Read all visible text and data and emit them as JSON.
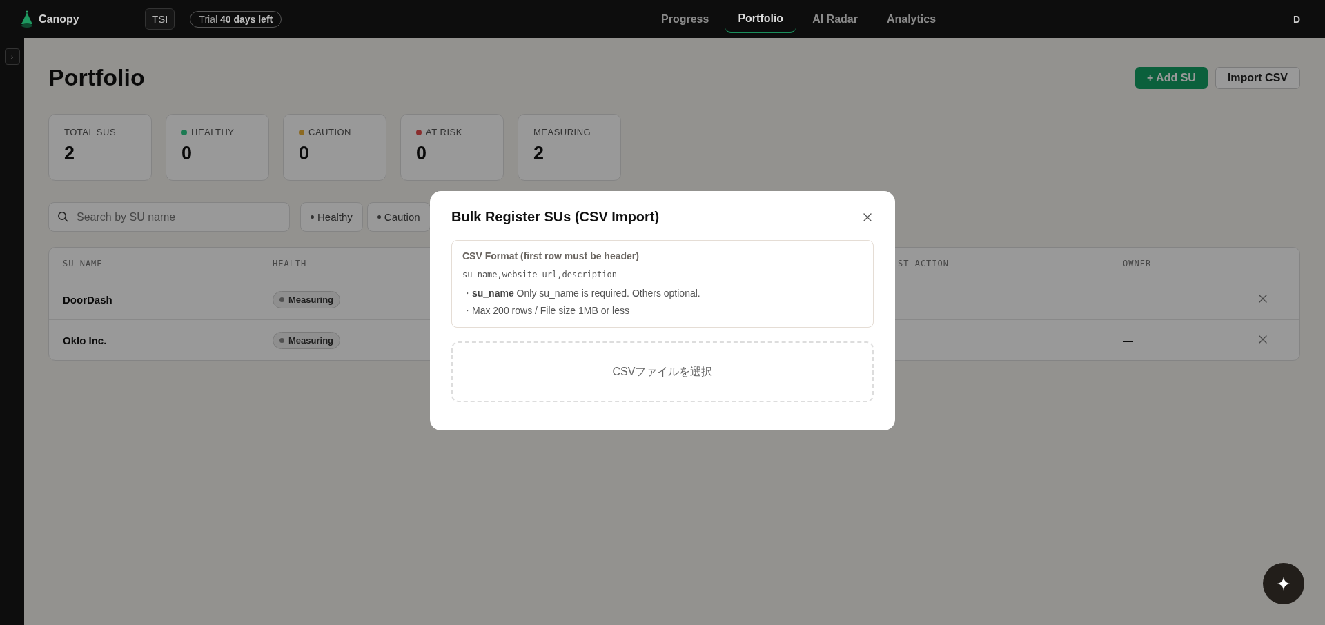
{
  "topbar": {
    "brand": "Canopy",
    "org": "TSI",
    "trial": "Trial **40 days left**",
    "nav": [
      {
        "label": "Progress",
        "selected": false
      },
      {
        "label": "Portfolio",
        "selected": true
      },
      {
        "label": "AI Radar",
        "selected": false
      },
      {
        "label": "Analytics",
        "selected": false
      }
    ],
    "user": "D"
  },
  "sidebar": {
    "toggle": "›"
  },
  "page": {
    "title": "Portfolio",
    "buttons": [
      {
        "label": "+ Add SU",
        "kind": "primary"
      },
      {
        "label": "Import CSV",
        "kind": "secondary"
      }
    ]
  },
  "stats": [
    {
      "label": "TOTAL SUS",
      "value": "2"
    },
    {
      "label": "HEALTHY",
      "value": "0",
      "color": "#1c7a52"
    },
    {
      "label": "CAUTION",
      "value": "0",
      "color": "#8c6a22"
    },
    {
      "label": "AT RISK",
      "value": "0",
      "color": "#8a2e2e"
    },
    {
      "label": "MEASURING",
      "value": "2"
    }
  ],
  "search": {
    "placeholder": "Search by SU name"
  },
  "filters": [
    {
      "label": "Healthy"
    },
    {
      "label": "Caution"
    }
  ],
  "table": {
    "columns": [
      "SU NAME",
      "HEALTH",
      "",
      "ST ACTION",
      "OWNER"
    ],
    "rows": [
      {
        "name": "DoorDash",
        "health": "Measuring",
        "owner": "—"
      },
      {
        "name": "Oklo Inc.",
        "health": "Measuring",
        "owner": "—"
      }
    ]
  },
  "modal": {
    "title": "Bulk Register SUs (CSV Import)",
    "format_title": "CSV Format (first row must be header)",
    "format_code": "su_name,website_url,description",
    "notes": [
      "・**su_name** Only su_name is required. Others optional.",
      "・Max 200 rows / File size 1MB or less"
    ],
    "dropzone": "CSVファイルを選択"
  }
}
